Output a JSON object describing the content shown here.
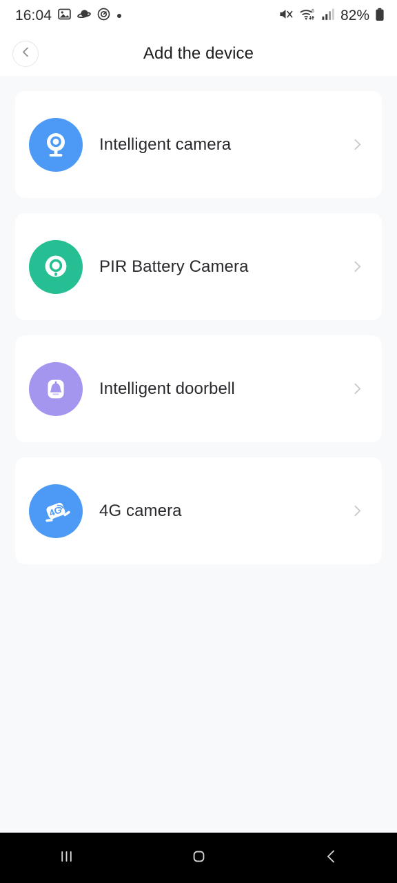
{
  "status_bar": {
    "time": "16:04",
    "battery_percent": "82%",
    "left_icons": [
      "gallery-icon",
      "saturn-icon",
      "alarm-icon",
      "dot-icon"
    ],
    "right_icons": [
      "mute-icon",
      "wifi6-icon",
      "cellular-signal-icon",
      "battery-icon"
    ]
  },
  "header": {
    "title": "Add the device",
    "back_icon": "chevron-left-icon"
  },
  "device_list": [
    {
      "label": "Intelligent camera",
      "icon": "webcam-icon",
      "color": "#4C9AF5",
      "chevron": "chevron-right-icon"
    },
    {
      "label": "PIR Battery Camera",
      "icon": "pir-camera-icon",
      "color": "#26BF93",
      "chevron": "chevron-right-icon"
    },
    {
      "label": "Intelligent doorbell",
      "icon": "doorbell-icon",
      "color": "#A495EF",
      "chevron": "chevron-right-icon"
    },
    {
      "label": "4G camera",
      "icon": "4g-camera-icon",
      "color": "#4C9AF5",
      "chevron": "chevron-right-icon"
    }
  ],
  "nav_bar": {
    "recents_icon": "recents-icon",
    "home_icon": "home-icon",
    "back_icon": "back-icon"
  },
  "theme": {
    "background": "#F8F9FB",
    "card_background": "#FFFFFF",
    "text_primary": "#2A2A2E",
    "chevron_color": "#C8C9CC",
    "nav_background": "#000000"
  }
}
